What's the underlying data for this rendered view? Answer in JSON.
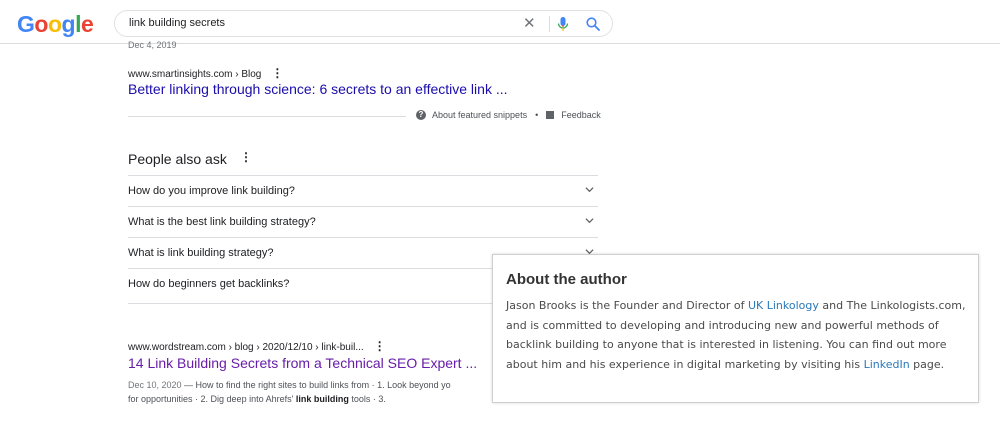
{
  "header": {
    "logo": {
      "letters": [
        "G",
        "o",
        "o",
        "g",
        "l",
        "e"
      ],
      "colors": [
        "#4285F4",
        "#EA4335",
        "#FBBC05",
        "#4285F4",
        "#34A853",
        "#EA4335"
      ]
    },
    "search_query": "link building secrets"
  },
  "results": {
    "cut_off_date": "Dec 4, 2019",
    "featured": {
      "cite": "www.smartinsights.com › Blog",
      "title": "Better linking through science: 6 secrets to an effective link ...",
      "about_label": "About featured snippets",
      "feedback_label": "Feedback"
    },
    "paa": {
      "heading": "People also ask",
      "questions": [
        "How do you improve link building?",
        "What is the best link building strategy?",
        "What is link building strategy?",
        "How do beginners get backlinks?"
      ]
    },
    "second": {
      "cite": "www.wordstream.com › blog › 2020/12/10 › link-buil...",
      "title": "14 Link Building Secrets from a Technical SEO Expert ...",
      "date": "Dec 10, 2020",
      "snippet_a": " — How to find the right sites to build links from · 1. Look beyond yo",
      "snippet_b": "for opportunities · 2. Dig deep into Ahrefs' ",
      "snippet_bold": "link building",
      "snippet_c": " tools · 3."
    }
  },
  "author_box": {
    "title": "About the author",
    "text_1": "Jason Brooks is the Founder and Director of ",
    "link_1": "UK Linkology",
    "text_2": " and The Linkologists.com, and is committed to developing and introducing new and powerful methods of backlink building to anyone that is interested in listening. You can find out more about him and his experience in digital marketing by visiting his ",
    "link_2": "LinkedIn",
    "text_3": " page."
  },
  "colors": {
    "link": "#1a0dab",
    "visited": "#681da8",
    "author_link": "#2a78b9"
  }
}
